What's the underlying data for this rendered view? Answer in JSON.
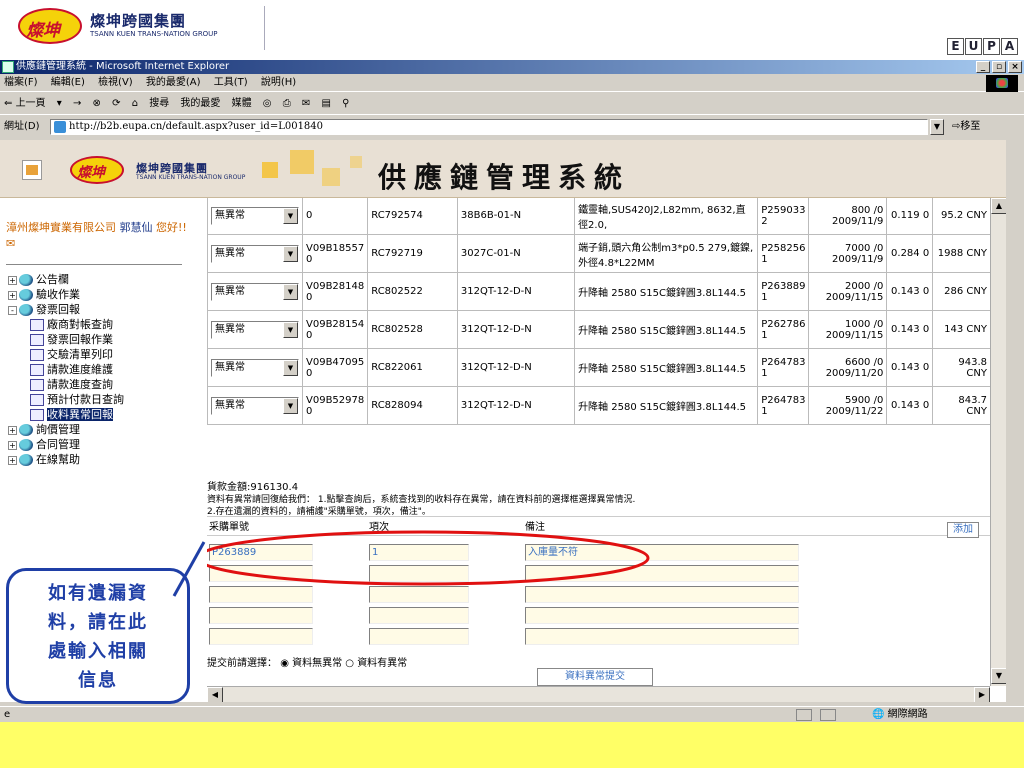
{
  "slide_header": {
    "brand_cn": "燦坤跨國集團",
    "brand_en": "TSANN KUEN TRANS-NATION GROUP",
    "logo_text": "燦坤",
    "eupa_letters": [
      "E",
      "U",
      "P",
      "A"
    ]
  },
  "window": {
    "title": "供應鏈管理系統 - Microsoft Internet Explorer",
    "menu": [
      "檔案(F)",
      "編輯(E)",
      "檢視(V)",
      "我的最愛(A)",
      "工具(T)",
      "說明(H)"
    ],
    "toolbar": [
      "上一頁",
      "→",
      "⊗",
      "⟳",
      "⌂",
      "搜尋",
      "我的最愛",
      "媒體",
      "◎",
      "⎙",
      "✉",
      "▤",
      "⚲"
    ],
    "address_label": "網址(D)",
    "address_value": "http://b2b.eupa.cn/default.aspx?user_id=L001840",
    "go_label": "移至"
  },
  "banner": {
    "system_title": "供應鏈管理系統",
    "brand_cn": "燦坤跨國集團",
    "brand_en": "TSANN KUEN TRANS-NATION GROUP",
    "logo_text": "燦坤"
  },
  "sidebar": {
    "company": "漳州燦坤實業有限公司",
    "user": "郭慧仙",
    "greeting": "您好!!",
    "tree": [
      {
        "label": "公告欄",
        "level": 0,
        "expand": "+"
      },
      {
        "label": "驗收作業",
        "level": 0,
        "expand": "+"
      },
      {
        "label": "發票回報",
        "level": 0,
        "expand": "-"
      },
      {
        "label": "廠商對帳查詢",
        "level": 1
      },
      {
        "label": "發票回報作業",
        "level": 1
      },
      {
        "label": "交驗清單列印",
        "level": 1
      },
      {
        "label": "請款進度維護",
        "level": 1
      },
      {
        "label": "請款進度查詢",
        "level": 1
      },
      {
        "label": "預計付款日查詢",
        "level": 1
      },
      {
        "label": "收料異常回報",
        "level": 1,
        "selected": true
      },
      {
        "label": "詢價管理",
        "level": 0,
        "expand": "+"
      },
      {
        "label": "合同管理",
        "level": 0,
        "expand": "+"
      },
      {
        "label": "在線幫助",
        "level": 0,
        "expand": "+"
      }
    ]
  },
  "table": {
    "rows": [
      {
        "status": "無異常",
        "po": "0",
        "rc": "RC792574",
        "part": "38B6B-01-N",
        "desc": "鐵靈軸,SUS420J2,L82mm, 8632,直徑2.0,",
        "p_code": "P259033 2",
        "qty_date": "800 /0 2009/11/9",
        "price": "0.119 0",
        "amount": "95.2 CNY"
      },
      {
        "status": "無異常",
        "po": "V09B18557 0",
        "rc": "RC792719",
        "part": "3027C-01-N",
        "desc": "端子銷,頭六角公制m3*p0.5 279,鍍鎳,外徑4.8*L22MM",
        "p_code": "P258256 1",
        "qty_date": "7000 /0 2009/11/9",
        "price": "0.284 0",
        "amount": "1988 CNY"
      },
      {
        "status": "無異常",
        "po": "V09B28148 0",
        "rc": "RC802522",
        "part": "312QT-12-D-N",
        "desc": "升降軸 2580 S15C鍍鋅圓3.8L144.5",
        "p_code": "P263889 1",
        "qty_date": "2000 /0 2009/11/15",
        "price": "0.143 0",
        "amount": "286 CNY"
      },
      {
        "status": "無異常",
        "po": "V09B28154 0",
        "rc": "RC802528",
        "part": "312QT-12-D-N",
        "desc": "升降軸 2580 S15C鍍鋅圓3.8L144.5",
        "p_code": "P262786 1",
        "qty_date": "1000 /0 2009/11/15",
        "price": "0.143 0",
        "amount": "143 CNY"
      },
      {
        "status": "無異常",
        "po": "V09B47095 0",
        "rc": "RC822061",
        "part": "312QT-12-D-N",
        "desc": "升降軸 2580 S15C鍍鋅圓3.8L144.5",
        "p_code": "P264783 1",
        "qty_date": "6600 /0 2009/11/20",
        "price": "0.143 0",
        "amount": "943.8 CNY"
      },
      {
        "status": "無異常",
        "po": "V09B52978 0",
        "rc": "RC828094",
        "part": "312QT-12-D-N",
        "desc": "升降軸 2580 S15C鍍鋅圓3.8L144.5",
        "p_code": "P264783 1",
        "qty_date": "5900 /0 2009/11/22",
        "price": "0.143 0",
        "amount": "843.7 CNY"
      }
    ]
  },
  "form": {
    "total": "貨款金額:916130.4",
    "notice1": "資料有異常請回復給我們： 1.點擊查詢后，系統查找到的收料存在異常，請在資料前的選擇框選擇異常情況.",
    "notice2": "2.存在遺漏的資料的，請補護\"采購單號，項次，備注\"。",
    "col_po": "采購單號",
    "col_item": "項次",
    "col_remark": "備注",
    "add_button": "添加",
    "rows": [
      {
        "po": "P263889",
        "item": "1",
        "remark": "入庫量不符"
      },
      {
        "po": "",
        "item": "",
        "remark": ""
      },
      {
        "po": "",
        "item": "",
        "remark": ""
      },
      {
        "po": "",
        "item": "",
        "remark": ""
      },
      {
        "po": "",
        "item": "",
        "remark": ""
      }
    ],
    "choice_label": "提交前請選擇：",
    "option_normal": "資料無異常",
    "option_abnormal": "資料有異常",
    "selected_option": "資料無異常",
    "submit_button": "資料異常提交"
  },
  "statusbar": {
    "zone": "網際網路"
  },
  "callout": {
    "lines": [
      "如有遺漏資",
      "料，請在此",
      "處輸入相關",
      "信息"
    ]
  },
  "colors": {
    "slide_bg": "#ffff66",
    "highlight_ellipse": "#e01010",
    "callout_border": "#1f3fa6",
    "link_orange": "#cc6600"
  }
}
